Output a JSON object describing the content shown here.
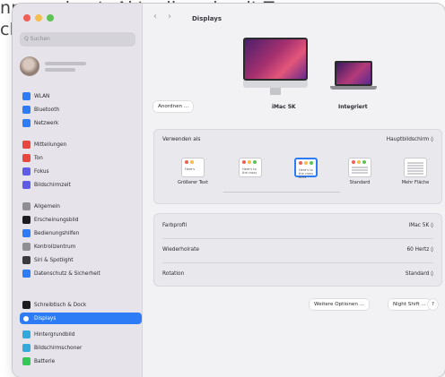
{
  "background_text": {
    "line1": "nnengebaut. Aktuell noch mit Tape",
    "line2": "ch"
  },
  "window": {
    "traffic_lights": [
      "#ee5f56",
      "#f4bd4f",
      "#5fc354"
    ]
  },
  "sidebar": {
    "search_placeholder": "Q Suchen",
    "items": [
      {
        "label": "WLAN",
        "icon": "wifi-icon",
        "color": "#2d7bf5"
      },
      {
        "label": "Bluetooth",
        "icon": "bluetooth-icon",
        "color": "#2d7bf5"
      },
      {
        "label": "Netzwerk",
        "icon": "globe-icon",
        "color": "#2d7bf5"
      },
      {
        "label": "Mitteilungen",
        "icon": "bell-icon",
        "color": "#e8473d"
      },
      {
        "label": "Ton",
        "icon": "speaker-icon",
        "color": "#e8473d"
      },
      {
        "label": "Fokus",
        "icon": "moon-icon",
        "color": "#5e5ce6"
      },
      {
        "label": "Bildschirmzeit",
        "icon": "hourglass-icon",
        "color": "#5e5ce6"
      },
      {
        "label": "Allgemein",
        "icon": "gear-icon",
        "color": "#8e8e93"
      },
      {
        "label": "Erscheinungsbild",
        "icon": "appearance-icon",
        "color": "#1c1c1e"
      },
      {
        "label": "Bedienungshilfen",
        "icon": "accessibility-icon",
        "color": "#2d7bf5"
      },
      {
        "label": "Kontrollzentrum",
        "icon": "control-center-icon",
        "color": "#8e8e93"
      },
      {
        "label": "Siri & Spotlight",
        "icon": "siri-icon",
        "color": "#3a3a3c"
      },
      {
        "label": "Datenschutz & Sicherheit",
        "icon": "hand-icon",
        "color": "#2d7bf5"
      },
      {
        "label": "Schreibtisch & Dock",
        "icon": "dock-icon",
        "color": "#1c1c1e"
      },
      {
        "label": "Displays",
        "icon": "sun-icon",
        "color": "#2d7bf5",
        "active": true
      },
      {
        "label": "Hintergrundbild",
        "icon": "wallpaper-icon",
        "color": "#34aadc"
      },
      {
        "label": "Bildschirmschoner",
        "icon": "screensaver-icon",
        "color": "#34aadc"
      },
      {
        "label": "Batterie",
        "icon": "battery-icon",
        "color": "#34c759"
      }
    ]
  },
  "main": {
    "back_glyph": "‹",
    "forward_glyph": "›",
    "title": "Displays",
    "arrange_button": "Anordnen ...",
    "display_names": [
      "iMac 5K",
      "Integriert"
    ],
    "add_button": "+",
    "use_as_label": "Verwenden als",
    "use_as_value": "Hauptbildschirm ◊",
    "resolution_options": [
      {
        "label": "Größerer Text",
        "preview": "Here's"
      },
      {
        "label": "",
        "preview": "Here's to the crazy"
      },
      {
        "label": "",
        "preview": "Here's to the crazy ones",
        "selected": true
      },
      {
        "label": "Standard",
        "preview": ""
      },
      {
        "label": "Mehr Fläche",
        "preview": ""
      }
    ],
    "settings": [
      {
        "label": "Farbprofil",
        "value": "iMac 5K ◊"
      },
      {
        "label": "Wiederholrate",
        "value": "60 Hertz ◊"
      },
      {
        "label": "Rotation",
        "value": "Standard ◊"
      }
    ],
    "more_options_button": "Weitere Optionen ...",
    "night_shift_button": "Night Shift ...",
    "help_button": "?"
  }
}
